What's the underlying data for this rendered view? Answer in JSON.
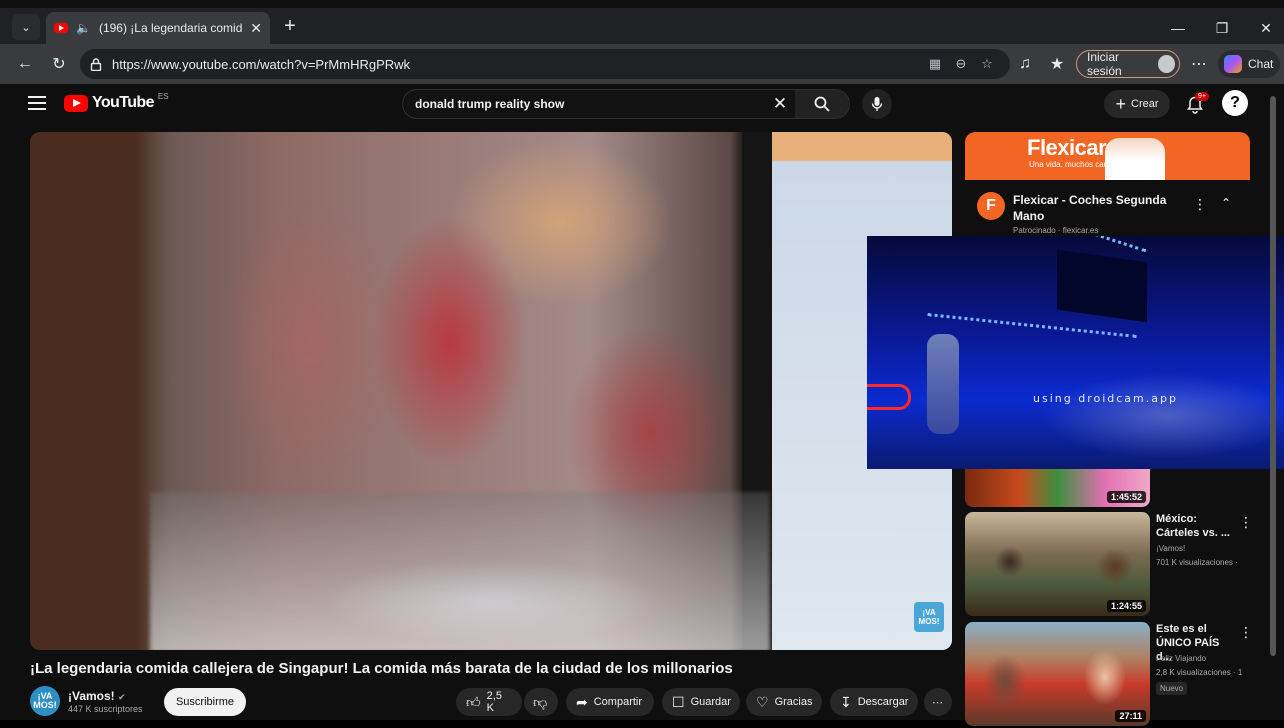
{
  "browser": {
    "tab_title": "(196) ¡La legendaria comida c",
    "url": "https://www.youtube.com/watch?v=PrMmHRgPRwk",
    "signin_label": "Iniciar sesión",
    "chat_label": "Chat"
  },
  "youtube": {
    "logo_text": "YouTube",
    "country_code": "ES",
    "search_query": "donald trump reality show",
    "create_label": "Crear",
    "notification_badge": "9+",
    "avatar_letter": "?"
  },
  "video": {
    "title": "¡La legendaria comida callejera de Singapur! La comida más barata de la ciudad de los millonarios",
    "watermark": "¡VA MOS!",
    "channel_name": "¡Vamos!",
    "channel_avatar_text": "¡VA MOS!",
    "subscribers": "447 K suscriptores",
    "subscribe_label": "Suscribirme",
    "likes": "2,5 K",
    "share_label": "Compartir",
    "save_label": "Guardar",
    "thanks_label": "Gracias",
    "download_label": "Descargar"
  },
  "ad": {
    "brand": "Flexicar",
    "tagline": "Una vida. muchos cars.",
    "logo_letter": "F",
    "title": "Flexicar - Coches Segunda Mano",
    "sponsor": "Patrocinado · flexicar.es"
  },
  "overlay": {
    "label": "using droidcam.app"
  },
  "recommendations": {
    "partial_duration": "1:45:52",
    "items": [
      {
        "title": "México: Cárteles vs. ...",
        "channel": "¡Vamos!",
        "views": "701 K visualizaciones ·",
        "duration": "1:24:55"
      },
      {
        "title": "Este es el ÚNICO PAÍS d...",
        "channel": "Feliz Viajando",
        "views": "2,8 K visualizaciones · 1",
        "badge": "Nuevo",
        "duration": "27:11"
      }
    ]
  },
  "icons": {
    "tab_search": "chevron-down-icon",
    "audio": "speaker-icon",
    "back": "back-arrow-icon",
    "reload": "reload-icon",
    "lock": "lock-icon",
    "search": "search-icon",
    "mic": "mic-icon",
    "bell": "bell-icon"
  },
  "colors": {
    "youtube_red": "#ff0000",
    "flexicar_orange": "#f26522",
    "page_bg": "#0f0f0f"
  }
}
